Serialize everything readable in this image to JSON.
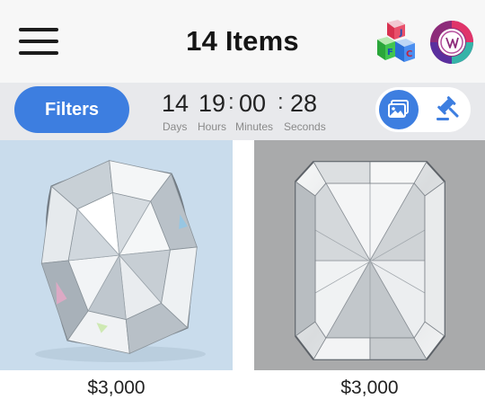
{
  "header": {
    "title": "14 Items",
    "blocks_letters": [
      "J",
      "F",
      "C"
    ]
  },
  "toolbar": {
    "filters_label": "Filters",
    "countdown": {
      "days": "14",
      "hours": "19",
      "minutes": "00",
      "seconds": "28",
      "days_label": "Days",
      "hours_label": "Hours",
      "minutes_label": "Minutes",
      "seconds_label": "Seconds"
    },
    "active_view": "gallery"
  },
  "items": [
    {
      "shape": "cushion",
      "price": "$3,000"
    },
    {
      "shape": "radiant",
      "price": "$3,000"
    }
  ],
  "colors": {
    "accent": "#3d7ee0",
    "header_bg": "#f7f7f7",
    "toolbar_bg": "#e8e9ec",
    "card0_bg": "#c9dcec",
    "card1_bg": "#a9aaab"
  },
  "icons": [
    "menu-icon",
    "abc-blocks-icon",
    "brand-logo-icon",
    "gallery-view-icon",
    "auction-gavel-icon"
  ]
}
